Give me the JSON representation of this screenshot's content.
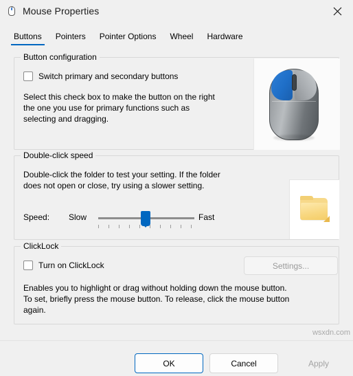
{
  "window": {
    "title": "Mouse Properties",
    "title_icon": "mouse-icon",
    "close_icon": "close-icon"
  },
  "tabs": [
    {
      "label": "Buttons",
      "selected": true
    },
    {
      "label": "Pointers",
      "selected": false
    },
    {
      "label": "Pointer Options",
      "selected": false
    },
    {
      "label": "Wheel",
      "selected": false
    },
    {
      "label": "Hardware",
      "selected": false
    }
  ],
  "button_config": {
    "group_title": "Button configuration",
    "switch_checkbox_label": "Switch primary and secondary buttons",
    "switch_checkbox_checked": false,
    "description_line1": "Select this check box to make the button on the right",
    "description_line2": "the one you use for primary functions such as",
    "description_line3": "selecting and dragging.",
    "preview_icon": "mouse-preview-image"
  },
  "double_click": {
    "group_title": "Double-click speed",
    "description_line1": "Double-click the folder to test your setting. If the folder",
    "description_line2": "does not open or close, try using a slower setting.",
    "speed_label": "Speed:",
    "slow_label": "Slow",
    "fast_label": "Fast",
    "slider_value_percent": 45,
    "folder_icon": "folder-icon"
  },
  "click_lock": {
    "group_title": "ClickLock",
    "checkbox_label": "Turn on ClickLock",
    "checkbox_checked": false,
    "settings_button_label": "Settings...",
    "settings_button_enabled": false,
    "description_line1": "Enables you to highlight or drag without holding down the mouse button.",
    "description_line2": "To set, briefly press the mouse button. To release, click the mouse button",
    "description_line3": "again."
  },
  "footer": {
    "ok_label": "OK",
    "cancel_label": "Cancel",
    "apply_label": "Apply",
    "apply_enabled": false
  },
  "watermark": "wsxdn.com",
  "colors": {
    "accent": "#0067c0",
    "window_bg": "#f0f0f0",
    "group_border": "#d8d8d8",
    "disabled_text": "#a3a3a3"
  }
}
